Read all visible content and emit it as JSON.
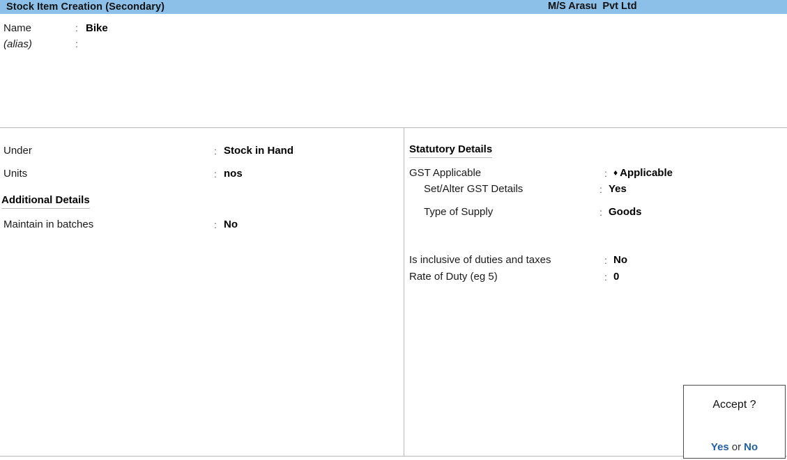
{
  "titlebar": {
    "screen_title": "Stock Item Creation (Secondary)",
    "company_name": "M/S Arasu  Pvt Ltd",
    "background_color": "#8cc0e8"
  },
  "identity": {
    "name_label": "Name",
    "name_colon": ":",
    "name_value": "Bike",
    "alias_label": "(alias)",
    "alias_colon": ":",
    "alias_value": ""
  },
  "left_panel": {
    "fields": [
      {
        "label": "Under",
        "colon": ":",
        "value": "Stock in Hand"
      },
      {
        "label": "Units",
        "colon": ":",
        "value": "nos"
      }
    ],
    "section_heading": "Additional Details",
    "additional_fields": [
      {
        "label": "Maintain in batches",
        "colon": ":",
        "value": "No"
      }
    ]
  },
  "right_panel": {
    "section_heading": "Statutory Details",
    "gst": {
      "label": "GST Applicable",
      "colon": ":",
      "marker": "♦",
      "value": "Applicable"
    },
    "gst_sub_fields": [
      {
        "label": "Set/Alter GST Details",
        "colon": ":",
        "value": "Yes"
      },
      {
        "label": "Type of Supply",
        "colon": ":",
        "value": "Goods"
      }
    ],
    "duty_fields": [
      {
        "label": "Is inclusive of duties and taxes",
        "colon": ":",
        "value": "No"
      },
      {
        "label": "Rate of Duty (eg 5)",
        "colon": ":",
        "value": "0"
      }
    ]
  },
  "accept_dialog": {
    "prompt": "Accept ?",
    "yes_label": "Yes",
    "or_label": "or",
    "no_label": "No",
    "accent_color": "#1f5fa9"
  }
}
